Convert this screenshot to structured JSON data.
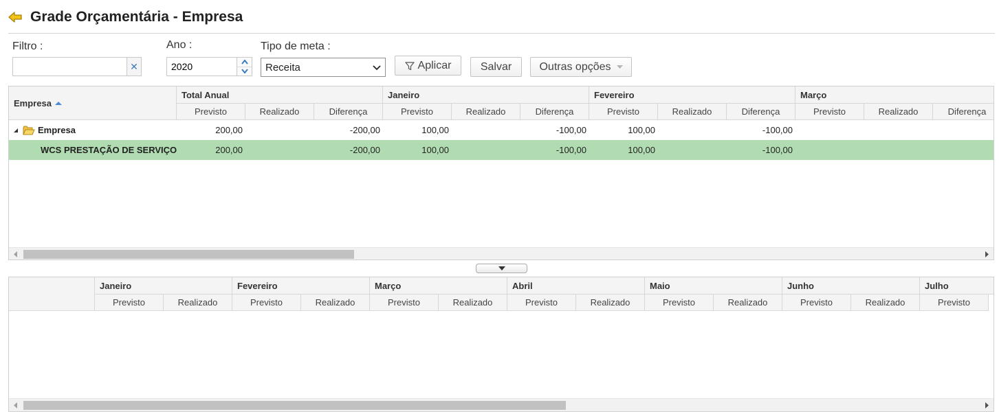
{
  "page": {
    "title": "Grade Orçamentária - Empresa"
  },
  "icons": {
    "back": "back-arrow-icon",
    "clear": "close-icon",
    "spin_up": "chevron-up-icon",
    "spin_down": "chevron-down-icon",
    "filter": "filter-icon",
    "dropdown": "chevron-down-icon",
    "folder": "folder-icon",
    "expand": "expand-triangle-icon",
    "sort": "sort-ascending-icon"
  },
  "colors": {
    "selected_row": "#b1dcb2",
    "header_bg": "#f4f4f4",
    "back_icon": "#f3c318",
    "accent": "#4a8bd2"
  },
  "toolbar": {
    "filtro_label": "Filtro :",
    "filtro_value": "",
    "ano_label": "Ano :",
    "ano_value": "2020",
    "tipo_label": "Tipo de meta :",
    "tipo_value": "Receita",
    "aplicar_label": "Aplicar",
    "salvar_label": "Salvar",
    "outras_label": "Outras opções"
  },
  "grid1": {
    "corner_label": "Empresa",
    "groups": [
      "Total Anual",
      "Janeiro",
      "Fevereiro",
      "Março"
    ],
    "sub_columns": [
      "Previsto",
      "Realizado",
      "Diferença"
    ],
    "rows": [
      {
        "name": "Empresa",
        "values": [
          "200,00",
          "",
          "-200,00",
          "100,00",
          "",
          "-100,00",
          "100,00",
          "",
          "-100,00",
          "",
          "",
          ""
        ]
      },
      {
        "name": "WCS PRESTAÇÃO DE SERVIÇOS",
        "values": [
          "200,00",
          "",
          "-200,00",
          "100,00",
          "",
          "-100,00",
          "100,00",
          "",
          "-100,00",
          "",
          "",
          ""
        ]
      }
    ]
  },
  "grid2": {
    "groups": [
      "Janeiro",
      "Fevereiro",
      "Março",
      "Abril",
      "Maio",
      "Junho",
      "Julho"
    ],
    "sub_columns": [
      "Previsto",
      "Realizado"
    ]
  }
}
